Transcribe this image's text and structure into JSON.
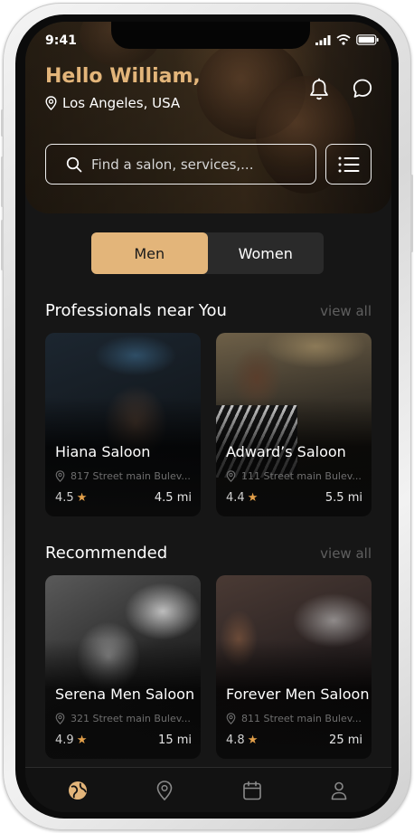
{
  "status_bar": {
    "time": "9:41"
  },
  "header": {
    "greeting": "Hello William,",
    "location": "Los Angeles, USA"
  },
  "search": {
    "placeholder": "Find a salon, services,..."
  },
  "toggle": {
    "men_label": "Men",
    "women_label": "Women",
    "selected": "Men"
  },
  "professionals": {
    "title": "Professionals near You",
    "view_all": "view all",
    "cards": [
      {
        "name": "Hiana Saloon",
        "address": "817 Street main Bulev...",
        "rating": "4.5",
        "distance": "4.5 mi"
      },
      {
        "name": "Adward’s Saloon",
        "address": "111 Street main Bulev...",
        "rating": "4.4",
        "distance": "5.5 mi"
      }
    ]
  },
  "recommended": {
    "title": "Recommended",
    "view_all": "view all",
    "cards": [
      {
        "name": "Serena Men Saloon",
        "address": "321 Street main Bulev...",
        "rating": "4.9",
        "distance": "15 mi"
      },
      {
        "name": "Forever Men Saloon",
        "address": "811 Street main Bulev...",
        "rating": "4.8",
        "distance": "25 mi"
      }
    ]
  },
  "bottom_nav": [
    {
      "icon": "explore-icon",
      "active": true
    },
    {
      "icon": "location-pin-icon",
      "active": false
    },
    {
      "icon": "calendar-icon",
      "active": false
    },
    {
      "icon": "profile-icon",
      "active": false
    }
  ],
  "colors": {
    "accent": "#e3b57a",
    "background": "#161616",
    "star": "#e3a04a",
    "muted": "#5f5f5f"
  }
}
